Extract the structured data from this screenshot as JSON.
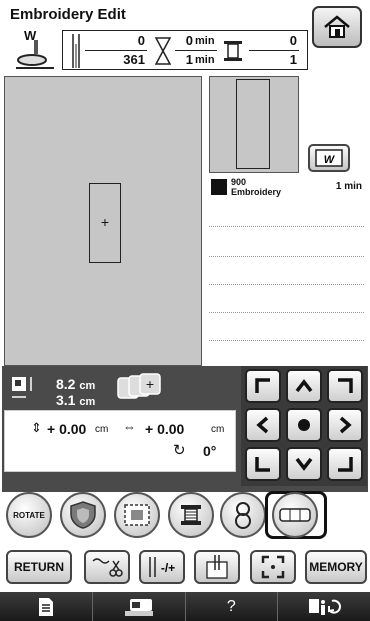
{
  "header": {
    "title": "Embroidery Edit"
  },
  "counters": {
    "presser_foot": "W",
    "stitch_current": "0",
    "stitch_total": "361",
    "time_current": "0",
    "time_total": "1",
    "time_unit": "min",
    "color_current": "0",
    "color_total": "1"
  },
  "thread_list": {
    "items": [
      {
        "number": "900",
        "name": "Embroidery",
        "time": "1 min",
        "color": "#111111"
      }
    ]
  },
  "size": {
    "height": "8.2",
    "width": "3.1",
    "unit": "cm"
  },
  "position": {
    "vertical": "+ 0.00",
    "horizontal": "+ 0.00",
    "unit": "cm",
    "rotation": "0°"
  },
  "edit_buttons": {
    "rotate_label": "ROTATE"
  },
  "bottom": {
    "return_label": "RETURN",
    "memory_label": "MEMORY"
  },
  "footer": {
    "help_label": "?"
  },
  "colors": {
    "panel_dark": "#4a4a4a",
    "canvas": "#c6c6c6"
  }
}
